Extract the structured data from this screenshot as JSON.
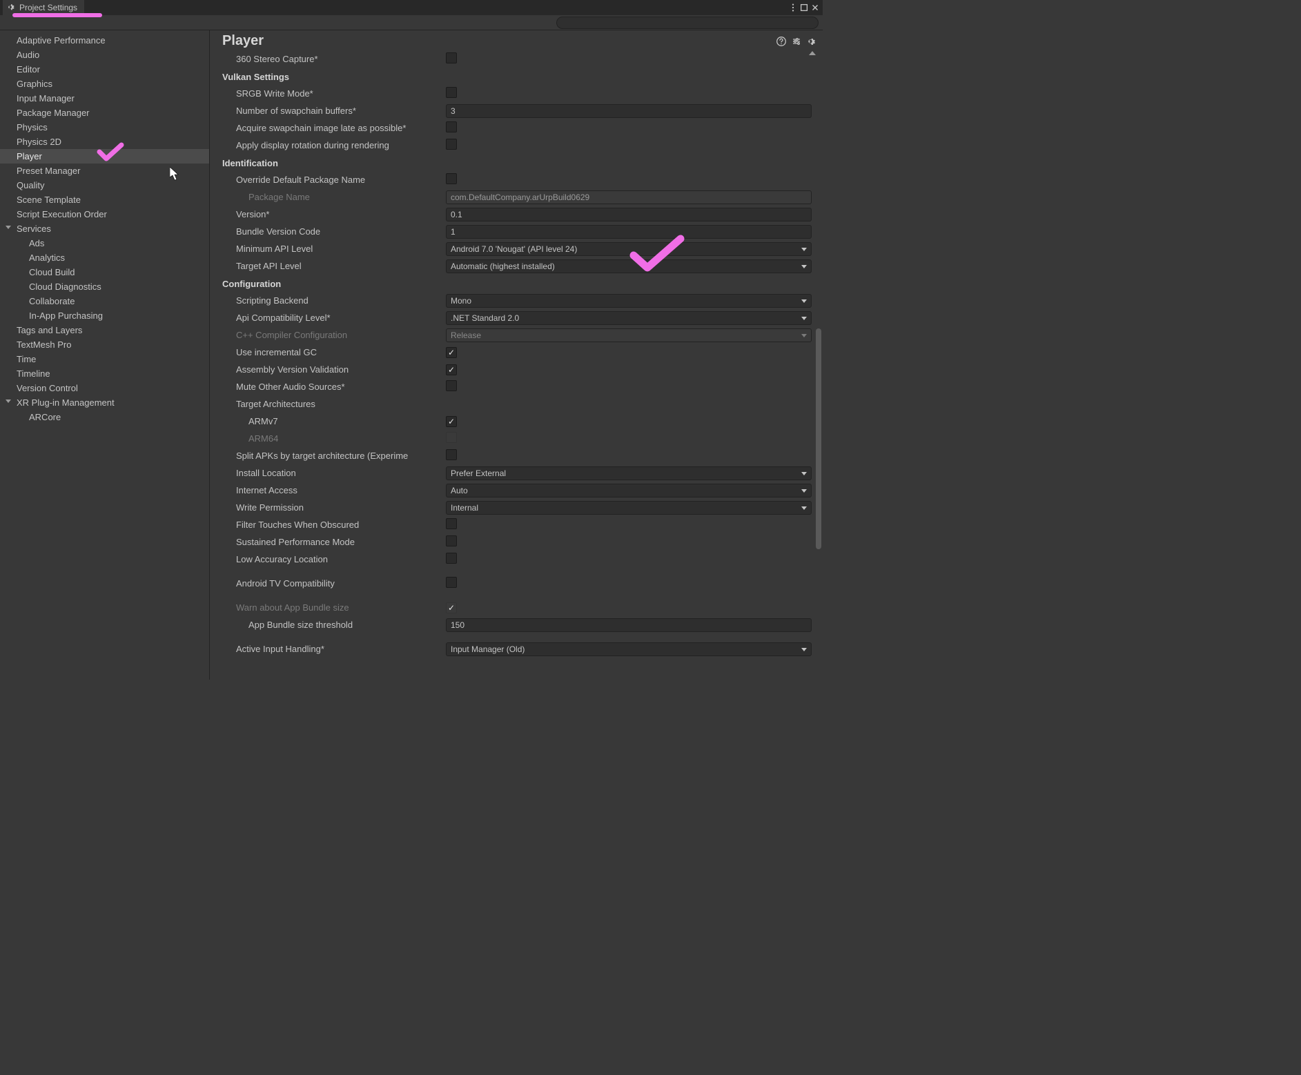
{
  "window": {
    "title": "Project Settings"
  },
  "search": {
    "placeholder": ""
  },
  "sidebar": {
    "items": [
      {
        "label": "Adaptive Performance"
      },
      {
        "label": "Audio"
      },
      {
        "label": "Editor"
      },
      {
        "label": "Graphics"
      },
      {
        "label": "Input Manager"
      },
      {
        "label": "Package Manager"
      },
      {
        "label": "Physics"
      },
      {
        "label": "Physics 2D"
      },
      {
        "label": "Player",
        "selected": true
      },
      {
        "label": "Preset Manager"
      },
      {
        "label": "Quality"
      },
      {
        "label": "Scene Template"
      },
      {
        "label": "Script Execution Order"
      },
      {
        "label": "Services",
        "foldout": true
      },
      {
        "label": "Ads",
        "indent": 1
      },
      {
        "label": "Analytics",
        "indent": 1
      },
      {
        "label": "Cloud Build",
        "indent": 1
      },
      {
        "label": "Cloud Diagnostics",
        "indent": 1
      },
      {
        "label": "Collaborate",
        "indent": 1
      },
      {
        "label": "In-App Purchasing",
        "indent": 1
      },
      {
        "label": "Tags and Layers"
      },
      {
        "label": "TextMesh Pro"
      },
      {
        "label": "Time"
      },
      {
        "label": "Timeline"
      },
      {
        "label": "Version Control"
      },
      {
        "label": "XR Plug-in Management",
        "foldout": true
      },
      {
        "label": "ARCore",
        "indent": 1
      }
    ]
  },
  "main": {
    "title": "Player",
    "rows": [
      {
        "kind": "checkbox",
        "label": "360 Stereo Capture*",
        "indent": 1,
        "checked": false
      },
      {
        "kind": "section",
        "label": "Vulkan Settings"
      },
      {
        "kind": "checkbox",
        "label": "SRGB Write Mode*",
        "indent": 1,
        "checked": false
      },
      {
        "kind": "text",
        "label": "Number of swapchain buffers*",
        "indent": 1,
        "value": "3"
      },
      {
        "kind": "checkbox",
        "label": "Acquire swapchain image late as possible*",
        "indent": 1,
        "checked": false
      },
      {
        "kind": "checkbox",
        "label": "Apply display rotation during rendering",
        "indent": 1,
        "checked": false
      },
      {
        "kind": "section",
        "label": "Identification"
      },
      {
        "kind": "checkbox",
        "label": "Override Default Package Name",
        "indent": 1,
        "checked": false
      },
      {
        "kind": "text",
        "label": "Package Name",
        "indent": 2,
        "value": "com.DefaultCompany.arUrpBuild0629",
        "readonly": true,
        "disabled": true
      },
      {
        "kind": "text",
        "label": "Version*",
        "indent": 1,
        "value": "0.1"
      },
      {
        "kind": "text",
        "label": "Bundle Version Code",
        "indent": 1,
        "value": "1"
      },
      {
        "kind": "dropdown",
        "label": "Minimum API Level",
        "indent": 1,
        "value": "Android 7.0 'Nougat' (API level 24)"
      },
      {
        "kind": "dropdown",
        "label": "Target API Level",
        "indent": 1,
        "value": "Automatic (highest installed)"
      },
      {
        "kind": "section",
        "label": "Configuration"
      },
      {
        "kind": "dropdown",
        "label": "Scripting Backend",
        "indent": 1,
        "value": "Mono"
      },
      {
        "kind": "dropdown",
        "label": "Api Compatibility Level*",
        "indent": 1,
        "value": ".NET Standard 2.0"
      },
      {
        "kind": "dropdown",
        "label": "C++ Compiler Configuration",
        "indent": 1,
        "value": "Release",
        "disabled": true
      },
      {
        "kind": "checkbox",
        "label": "Use incremental GC",
        "indent": 1,
        "checked": true
      },
      {
        "kind": "checkbox",
        "label": "Assembly Version Validation",
        "indent": 1,
        "checked": true
      },
      {
        "kind": "checkbox",
        "label": "Mute Other Audio Sources*",
        "indent": 1,
        "checked": false
      },
      {
        "kind": "labelonly",
        "label": "Target Architectures",
        "indent": 1
      },
      {
        "kind": "checkbox",
        "label": "ARMv7",
        "indent": 2,
        "checked": true
      },
      {
        "kind": "checkbox",
        "label": "ARM64",
        "indent": 2,
        "checked": false,
        "disabled": true
      },
      {
        "kind": "checkbox",
        "label": "Split APKs by target architecture (Experime",
        "indent": 1,
        "checked": false
      },
      {
        "kind": "dropdown",
        "label": "Install Location",
        "indent": 1,
        "value": "Prefer External"
      },
      {
        "kind": "dropdown",
        "label": "Internet Access",
        "indent": 1,
        "value": "Auto"
      },
      {
        "kind": "dropdown",
        "label": "Write Permission",
        "indent": 1,
        "value": "Internal"
      },
      {
        "kind": "checkbox",
        "label": "Filter Touches When Obscured",
        "indent": 1,
        "checked": false
      },
      {
        "kind": "checkbox",
        "label": "Sustained Performance Mode",
        "indent": 1,
        "checked": false
      },
      {
        "kind": "checkbox",
        "label": "Low Accuracy Location",
        "indent": 1,
        "checked": false
      },
      {
        "kind": "spacer"
      },
      {
        "kind": "checkbox",
        "label": "Android TV Compatibility",
        "indent": 1,
        "checked": false
      },
      {
        "kind": "spacer"
      },
      {
        "kind": "checkbox",
        "label": "Warn about App Bundle size",
        "indent": 1,
        "checked": true,
        "disabled": true
      },
      {
        "kind": "text",
        "label": "App Bundle size threshold",
        "indent": 2,
        "value": "150"
      },
      {
        "kind": "spacer"
      },
      {
        "kind": "dropdown",
        "label": "Active Input Handling*",
        "indent": 1,
        "value": "Input Manager (Old)"
      }
    ]
  }
}
